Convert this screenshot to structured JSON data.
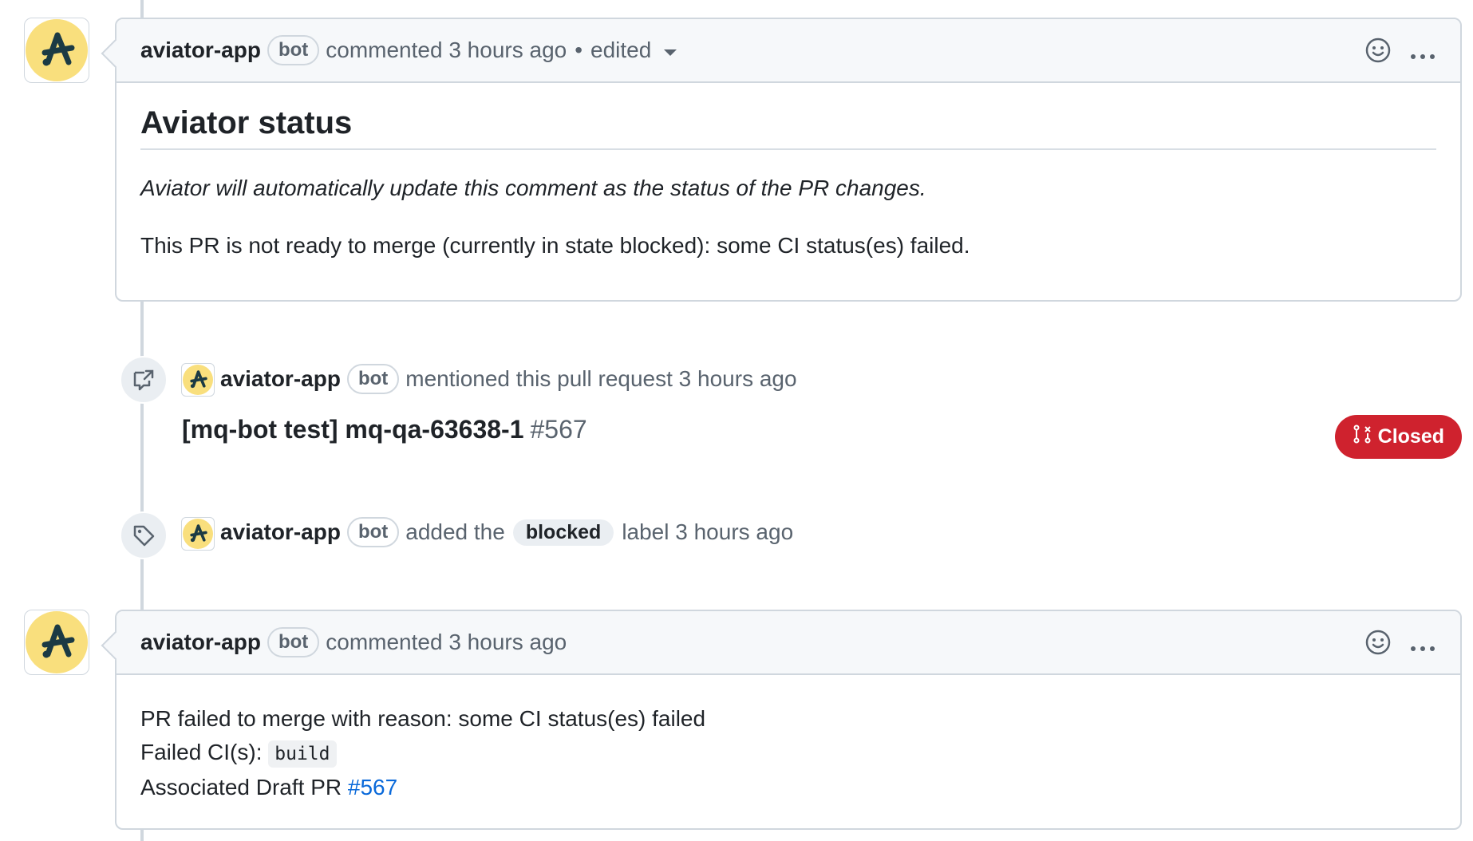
{
  "comment1": {
    "author": "aviator-app",
    "badge": "bot",
    "meta": "commented 3 hours ago",
    "separator": "•",
    "edited": "edited",
    "title": "Aviator status",
    "note": "Aviator will automatically update this comment as the status of the PR changes.",
    "status": "This PR is not ready to merge (currently in state blocked): some CI status(es) failed."
  },
  "event1": {
    "author": "aviator-app",
    "badge": "bot",
    "text": "mentioned this pull request 3 hours ago",
    "pr_title": "[mq-bot test] mq-qa-63638-1",
    "pr_number": "#567",
    "state": "Closed"
  },
  "event2": {
    "author": "aviator-app",
    "badge": "bot",
    "text_before": "added the",
    "label": "blocked",
    "text_after": "label 3 hours ago"
  },
  "comment2": {
    "author": "aviator-app",
    "badge": "bot",
    "meta": "commented 3 hours ago",
    "line1": "PR failed to merge with reason: some CI status(es) failed",
    "line2_label": "Failed CI(s):",
    "line2_code": "build",
    "line3_label": "Associated Draft PR",
    "line3_link": "#567"
  },
  "icons": {
    "avatar": "aviator-logo",
    "reaction": "smiley-icon",
    "more": "kebab-horizontal-icon",
    "cross_reference": "cross-reference-icon",
    "tag": "tag-icon",
    "pr_closed": "git-pull-request-closed-icon"
  },
  "colors": {
    "avatar_bg": "#f9df7d",
    "closed_badge": "#cf222e",
    "link": "#0969da"
  }
}
